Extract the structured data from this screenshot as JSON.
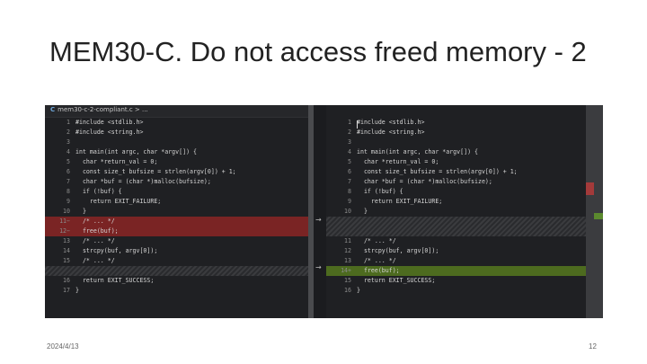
{
  "slide": {
    "title": "MEM30-C. Do not access freed memory - 2",
    "date": "2024/4/13",
    "page_number": "12"
  },
  "editor": {
    "tab_label": "mem30-c-2-compliant.c > ...",
    "tab_icon": "C",
    "colors": {
      "removed": "#7a2424",
      "added": "#4d6b1f",
      "background": "#1e1f22"
    },
    "left_lines": [
      {
        "ln": "1",
        "code": "#include <stdlib.h>",
        "type": "normal"
      },
      {
        "ln": "2",
        "code": "#include <string.h>",
        "type": "normal"
      },
      {
        "ln": "3",
        "code": "",
        "type": "normal"
      },
      {
        "ln": "4",
        "code": "int main(int argc, char *argv[]) {",
        "type": "normal"
      },
      {
        "ln": "5",
        "code": "  char *return_val = 0;",
        "type": "normal"
      },
      {
        "ln": "6",
        "code": "  const size_t bufsize = strlen(argv[0]) + 1;",
        "type": "normal"
      },
      {
        "ln": "7",
        "code": "  char *buf = (char *)malloc(bufsize);",
        "type": "normal"
      },
      {
        "ln": "8",
        "code": "  if (!buf) {",
        "type": "normal"
      },
      {
        "ln": "9",
        "code": "    return EXIT_FAILURE;",
        "type": "normal"
      },
      {
        "ln": "10",
        "code": "  }",
        "type": "normal"
      },
      {
        "ln": "11−",
        "code": "  /* ... */",
        "type": "removed"
      },
      {
        "ln": "12−",
        "code": "  free(buf);",
        "type": "removed"
      },
      {
        "ln": "13",
        "code": "  /* ... */",
        "type": "normal"
      },
      {
        "ln": "14",
        "code": "  strcpy(buf, argv[0]);",
        "type": "normal"
      },
      {
        "ln": "15",
        "code": "  /* ... */",
        "type": "normal"
      },
      {
        "ln": "",
        "code": "",
        "type": "hatch"
      },
      {
        "ln": "16",
        "code": "  return EXIT_SUCCESS;",
        "type": "normal"
      },
      {
        "ln": "17",
        "code": "}",
        "type": "normal"
      }
    ],
    "right_lines": [
      {
        "ln": "1",
        "code": "#include <stdlib.h>",
        "type": "normal"
      },
      {
        "ln": "2",
        "code": "#include <string.h>",
        "type": "normal"
      },
      {
        "ln": "3",
        "code": "",
        "type": "normal"
      },
      {
        "ln": "4",
        "code": "int main(int argc, char *argv[]) {",
        "type": "normal"
      },
      {
        "ln": "5",
        "code": "  char *return_val = 0;",
        "type": "normal"
      },
      {
        "ln": "6",
        "code": "  const size_t bufsize = strlen(argv[0]) + 1;",
        "type": "normal"
      },
      {
        "ln": "7",
        "code": "  char *buf = (char *)malloc(bufsize);",
        "type": "normal"
      },
      {
        "ln": "8",
        "code": "  if (!buf) {",
        "type": "normal"
      },
      {
        "ln": "9",
        "code": "    return EXIT_FAILURE;",
        "type": "normal"
      },
      {
        "ln": "10",
        "code": "  }",
        "type": "normal"
      },
      {
        "ln": "",
        "code": "",
        "type": "hatch2"
      },
      {
        "ln": "11",
        "code": "  /* ... */",
        "type": "normal"
      },
      {
        "ln": "12",
        "code": "  strcpy(buf, argv[0]);",
        "type": "normal"
      },
      {
        "ln": "13",
        "code": "  /* ... */",
        "type": "normal"
      },
      {
        "ln": "14+",
        "code": "  free(buf);",
        "type": "added"
      },
      {
        "ln": "15",
        "code": "  return EXIT_SUCCESS;",
        "type": "normal"
      },
      {
        "ln": "16",
        "code": "}",
        "type": "normal"
      }
    ],
    "arrows": [
      "→",
      "→"
    ]
  }
}
